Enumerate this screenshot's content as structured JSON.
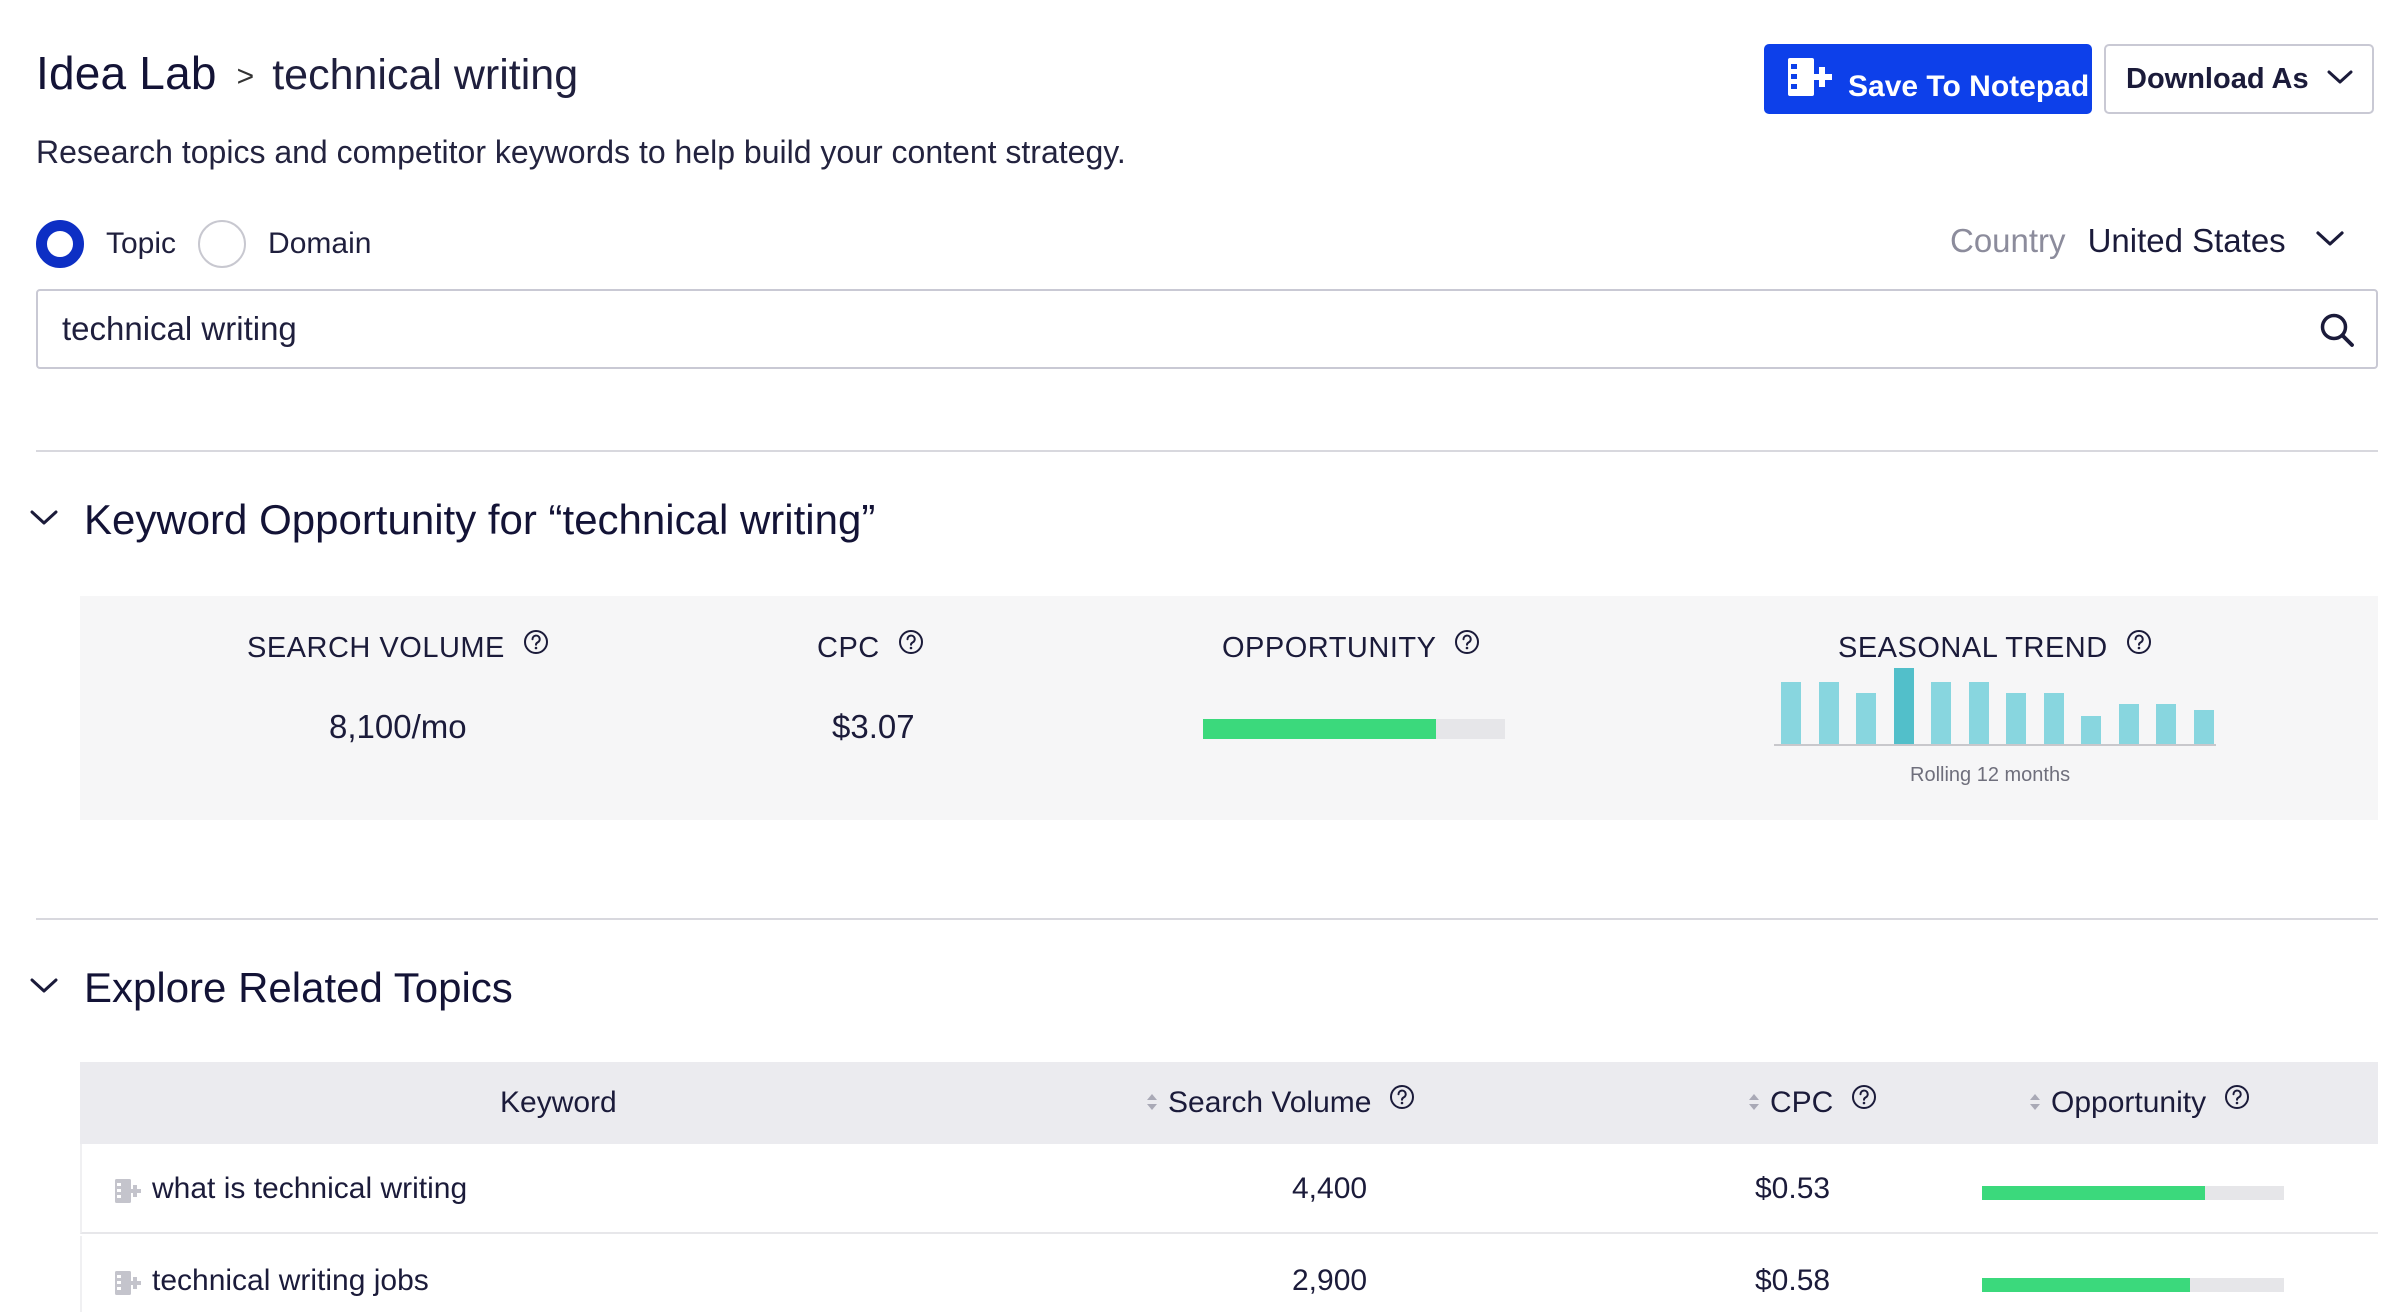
{
  "header": {
    "app_title": "Idea Lab",
    "breadcrumb_separator": ">",
    "page_title": "technical writing",
    "subtitle": "Research topics and competitor keywords to help build your content strategy.",
    "save_label": "Save To Notepad",
    "download_label": "Download As"
  },
  "search_mode": {
    "options": [
      {
        "label": "Topic",
        "selected": true
      },
      {
        "label": "Domain",
        "selected": false
      }
    ]
  },
  "country": {
    "label": "Country",
    "value": "United States"
  },
  "search": {
    "value": "technical writing"
  },
  "keyword_opportunity": {
    "heading": "Keyword Opportunity for “technical writing”",
    "search_volume_label": "SEARCH VOLUME",
    "search_volume_value": "8,100/mo",
    "cpc_label": "CPC",
    "cpc_value": "$3.07",
    "opportunity_label": "OPPORTUNITY",
    "opportunity_fraction": 0.77,
    "seasonal_trend_label": "SEASONAL TREND",
    "seasonal_trend_caption": "Rolling 12 months",
    "seasonal_trend_values": [
      40,
      40,
      33,
      49,
      40,
      40,
      33,
      33,
      18,
      26,
      26,
      22
    ],
    "seasonal_trend_highlight_index": 3
  },
  "related_topics": {
    "heading": "Explore Related Topics",
    "columns": {
      "keyword": "Keyword",
      "search_volume": "Search Volume",
      "cpc": "CPC",
      "opportunity": "Opportunity"
    },
    "rows": [
      {
        "keyword": "what is technical writing",
        "search_volume": "4,400",
        "cpc": "$0.53",
        "opportunity": 0.74
      },
      {
        "keyword": "technical writing jobs",
        "search_volume": "2,900",
        "cpc": "$0.58",
        "opportunity": 0.69
      }
    ]
  },
  "colors": {
    "primary": "#0d40ea",
    "opportunity_fill": "#3bd97c",
    "trend_bar": "#88d6df",
    "trend_bar_highlight": "#52bfca",
    "panel_bg": "#f6f6f7"
  }
}
